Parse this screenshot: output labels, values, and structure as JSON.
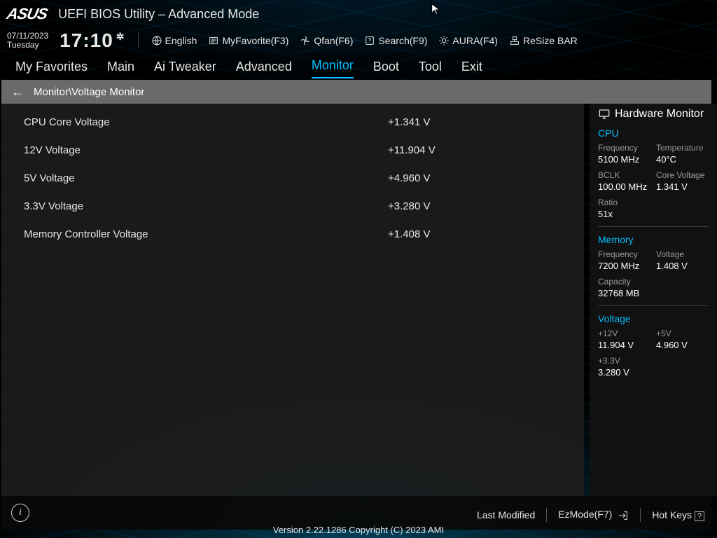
{
  "header": {
    "brand": "ASUS",
    "title": "UEFI BIOS Utility – Advanced Mode",
    "date": "07/11/2023",
    "day": "Tuesday",
    "time": "17:10"
  },
  "toolbar": {
    "language": "English",
    "myfav": "MyFavorite(F3)",
    "qfan": "Qfan(F6)",
    "search": "Search(F9)",
    "aura": "AURA(F4)",
    "resize": "ReSize BAR"
  },
  "tabs": [
    "My Favorites",
    "Main",
    "Ai Tweaker",
    "Advanced",
    "Monitor",
    "Boot",
    "Tool",
    "Exit"
  ],
  "tabs_active": 4,
  "breadcrumb": "Monitor\\Voltage Monitor",
  "rows": [
    {
      "label": "CPU Core Voltage",
      "value": "+1.341 V"
    },
    {
      "label": "12V Voltage",
      "value": "+11.904 V"
    },
    {
      "label": "5V Voltage",
      "value": "+4.960 V"
    },
    {
      "label": "3.3V Voltage",
      "value": "+3.280 V"
    },
    {
      "label": "Memory Controller Voltage",
      "value": "+1.408 V"
    }
  ],
  "sidebar": {
    "title": "Hardware Monitor",
    "cpu": {
      "heading": "CPU",
      "freq_k": "Frequency",
      "freq_v": "5100 MHz",
      "temp_k": "Temperature",
      "temp_v": "40°C",
      "bclk_k": "BCLK",
      "bclk_v": "100.00 MHz",
      "cv_k": "Core Voltage",
      "cv_v": "1.341 V",
      "ratio_k": "Ratio",
      "ratio_v": "51x"
    },
    "mem": {
      "heading": "Memory",
      "freq_k": "Frequency",
      "freq_v": "7200 MHz",
      "volt_k": "Voltage",
      "volt_v": "1.408 V",
      "cap_k": "Capacity",
      "cap_v": "32768 MB"
    },
    "volt": {
      "heading": "Voltage",
      "v12_k": "+12V",
      "v12_v": "11.904 V",
      "v5_k": "+5V",
      "v5_v": "4.960 V",
      "v33_k": "+3.3V",
      "v33_v": "3.280 V"
    }
  },
  "footer": {
    "last": "Last Modified",
    "ez": "EzMode(F7)",
    "hot": "Hot Keys",
    "version": "Version 2.22.1286 Copyright (C) 2023 AMI"
  }
}
